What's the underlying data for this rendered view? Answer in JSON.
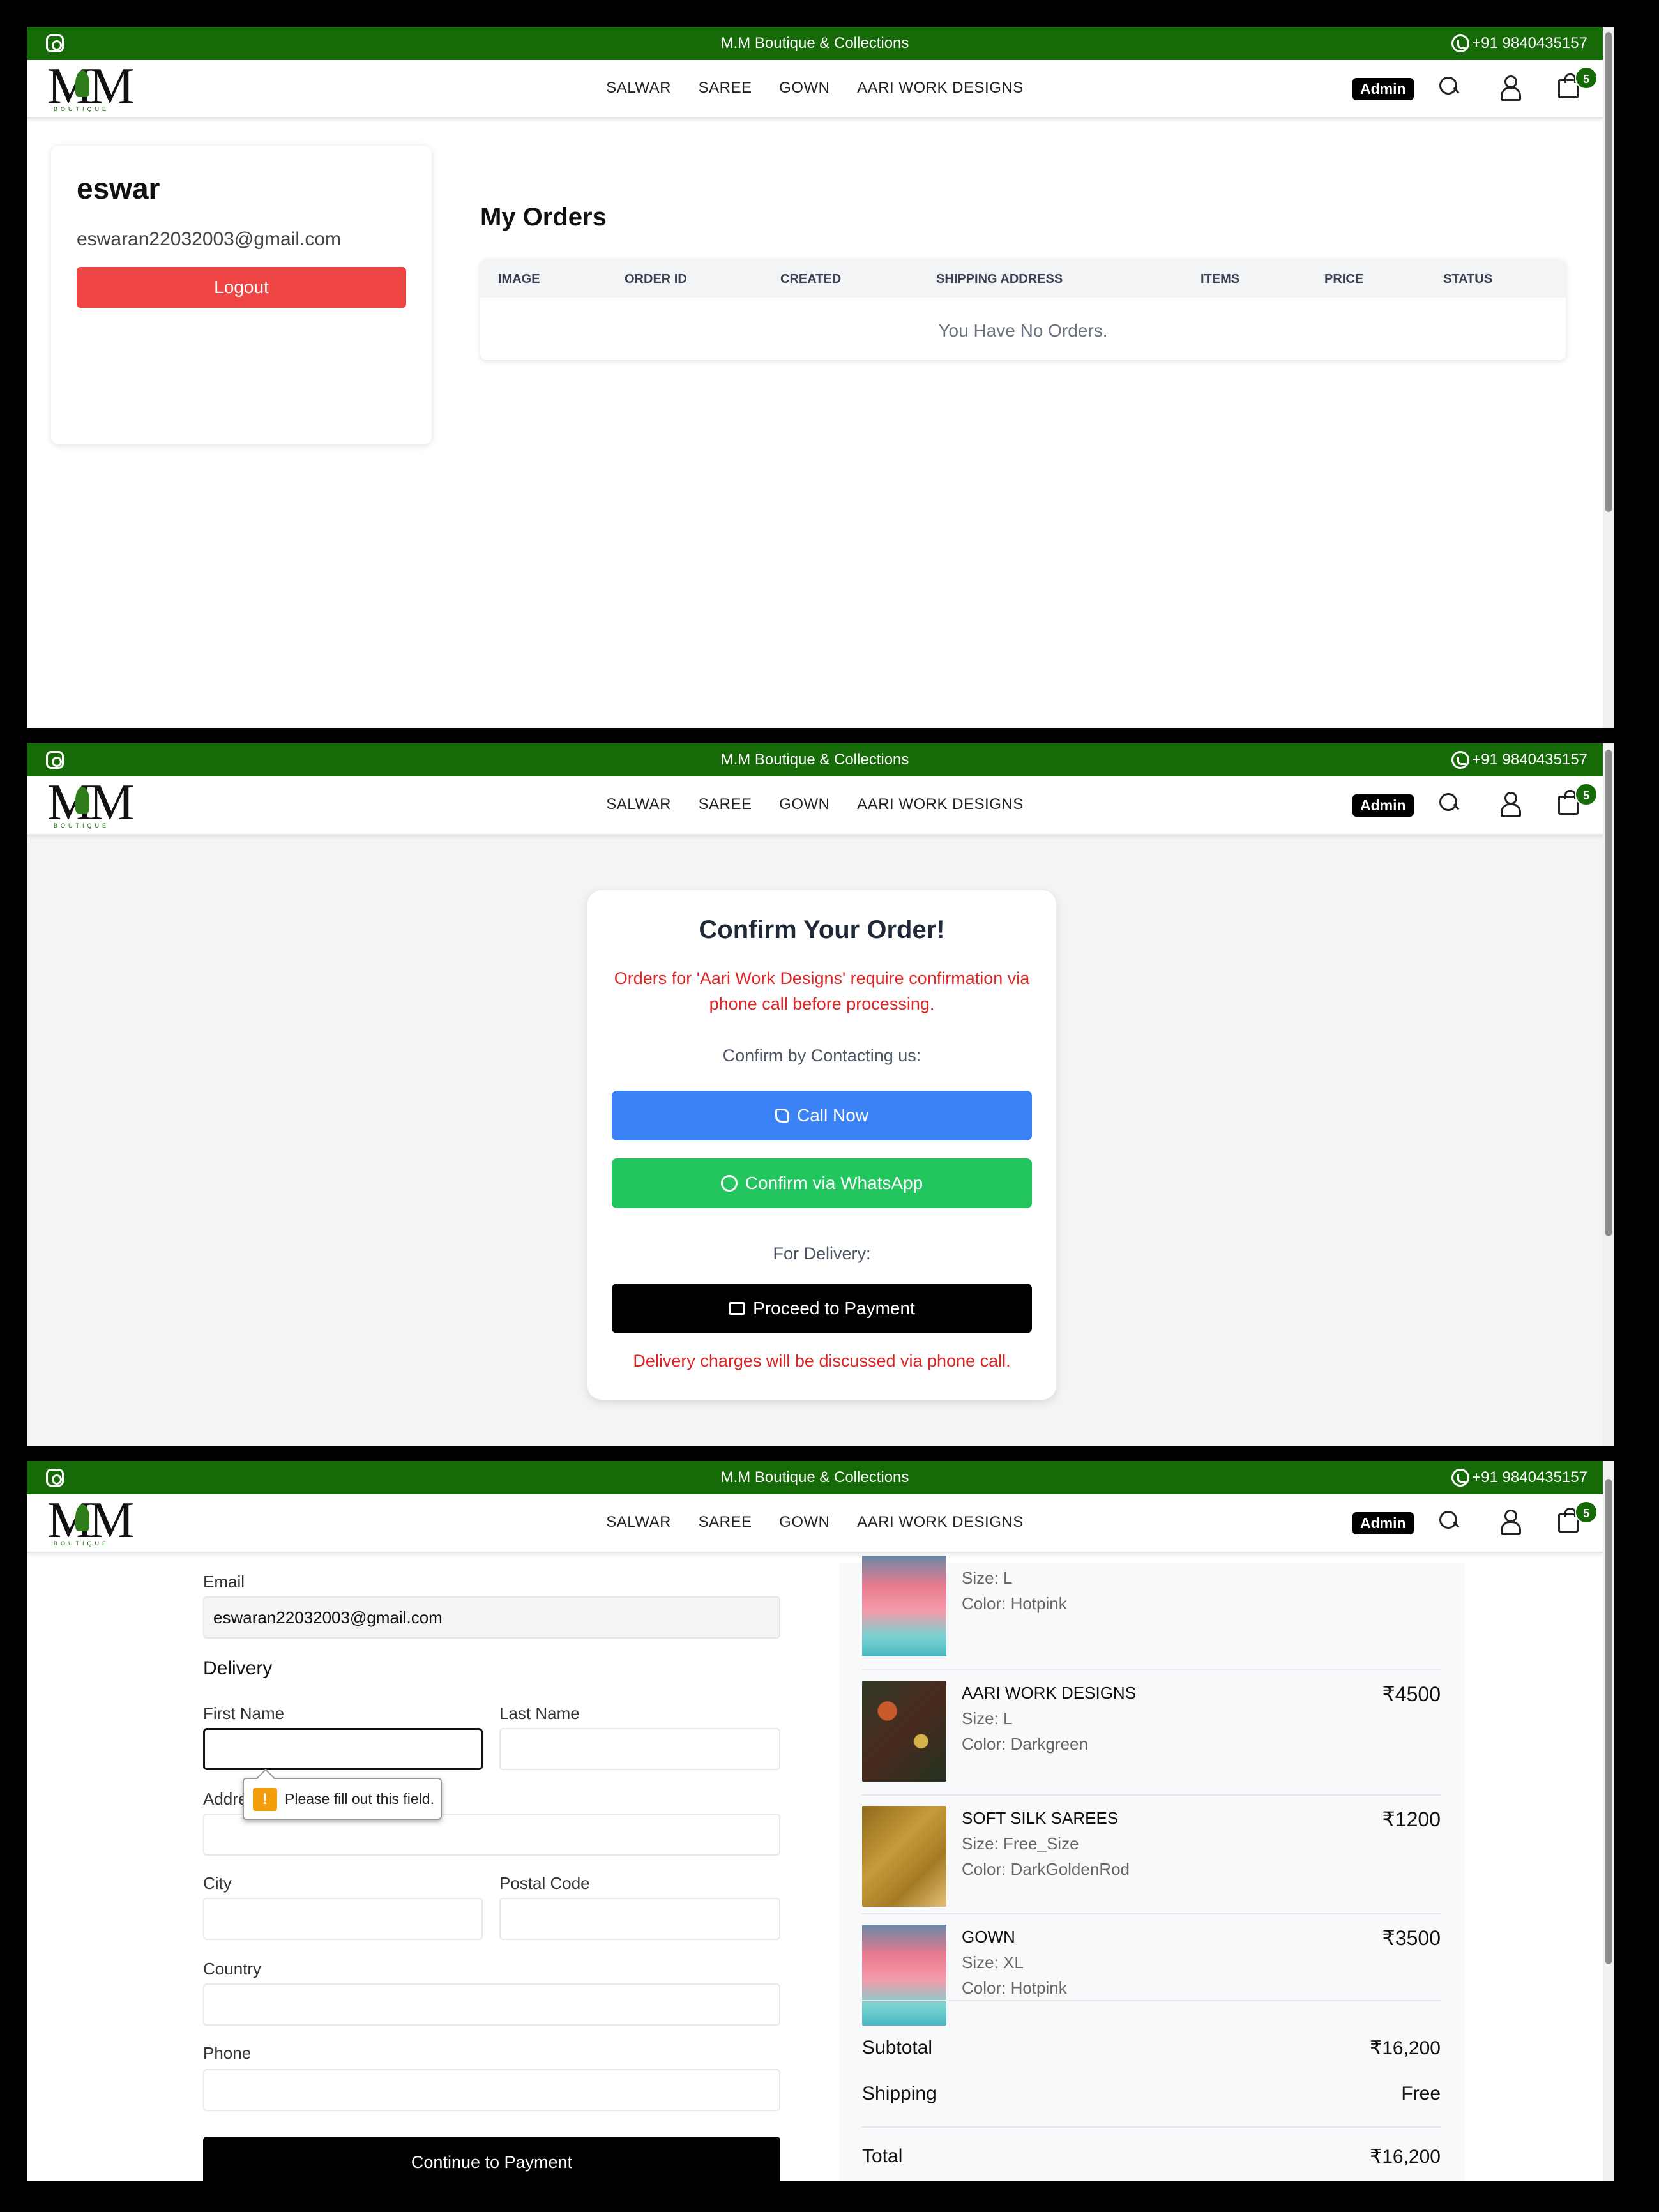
{
  "header": {
    "store_title": "M.M Boutique & Collections",
    "phone": "+91 9840435157",
    "logo_text": "MM",
    "logo_sub": "BOUTIQUE",
    "nav": [
      "SALWAR",
      "SAREE",
      "GOWN",
      "AARI WORK DESIGNS"
    ],
    "admin_label": "Admin",
    "cart_count": "5",
    "brand_color": "#166a07"
  },
  "profile": {
    "name": "eswar",
    "email": "eswaran22032003@gmail.com",
    "logout_label": "Logout"
  },
  "orders": {
    "title": "My Orders",
    "columns": [
      "IMAGE",
      "ORDER ID",
      "CREATED",
      "SHIPPING ADDRESS",
      "ITEMS",
      "PRICE",
      "STATUS"
    ],
    "empty_message": "You Have No Orders."
  },
  "confirm": {
    "title": "Confirm Your Order!",
    "note": "Orders for 'Aari Work Designs' require confirmation via phone call before processing.",
    "contact_label": "Confirm by Contacting us:",
    "call_label": "Call Now",
    "whatsapp_label": "Confirm via WhatsApp",
    "delivery_label": "For Delivery:",
    "payment_label": "Proceed to Payment",
    "delivery_note": "Delivery charges will be discussed via phone call."
  },
  "checkout": {
    "email_label": "Email",
    "email_value": "eswaran22032003@gmail.com",
    "delivery_title": "Delivery",
    "first_name_label": "First Name",
    "last_name_label": "Last Name",
    "address_label": "Address",
    "city_label": "City",
    "postal_label": "Postal Code",
    "country_label": "Country",
    "phone_label": "Phone",
    "validation_message": "Please fill out this field.",
    "continue_label": "Continue to Payment"
  },
  "summary": {
    "items": [
      {
        "name": "",
        "size": "Size: L",
        "color": "Color: Hotpink",
        "price": "",
        "thumb": "gown"
      },
      {
        "name": "AARI WORK DESIGNS",
        "size": "Size: L",
        "color": "Color: Darkgreen",
        "price": "₹4500",
        "thumb": "aari"
      },
      {
        "name": "SOFT SILK SAREES",
        "size": "Size: Free_Size",
        "color": "Color: DarkGoldenRod",
        "price": "₹1200",
        "thumb": "silk"
      },
      {
        "name": "GOWN",
        "size": "Size: XL",
        "color": "Color: Hotpink",
        "price": "₹3500",
        "thumb": "gown"
      }
    ],
    "subtotal_label": "Subtotal",
    "subtotal_value": "₹16,200",
    "shipping_label": "Shipping",
    "shipping_value": "Free",
    "total_label": "Total",
    "total_value": "₹16,200"
  }
}
